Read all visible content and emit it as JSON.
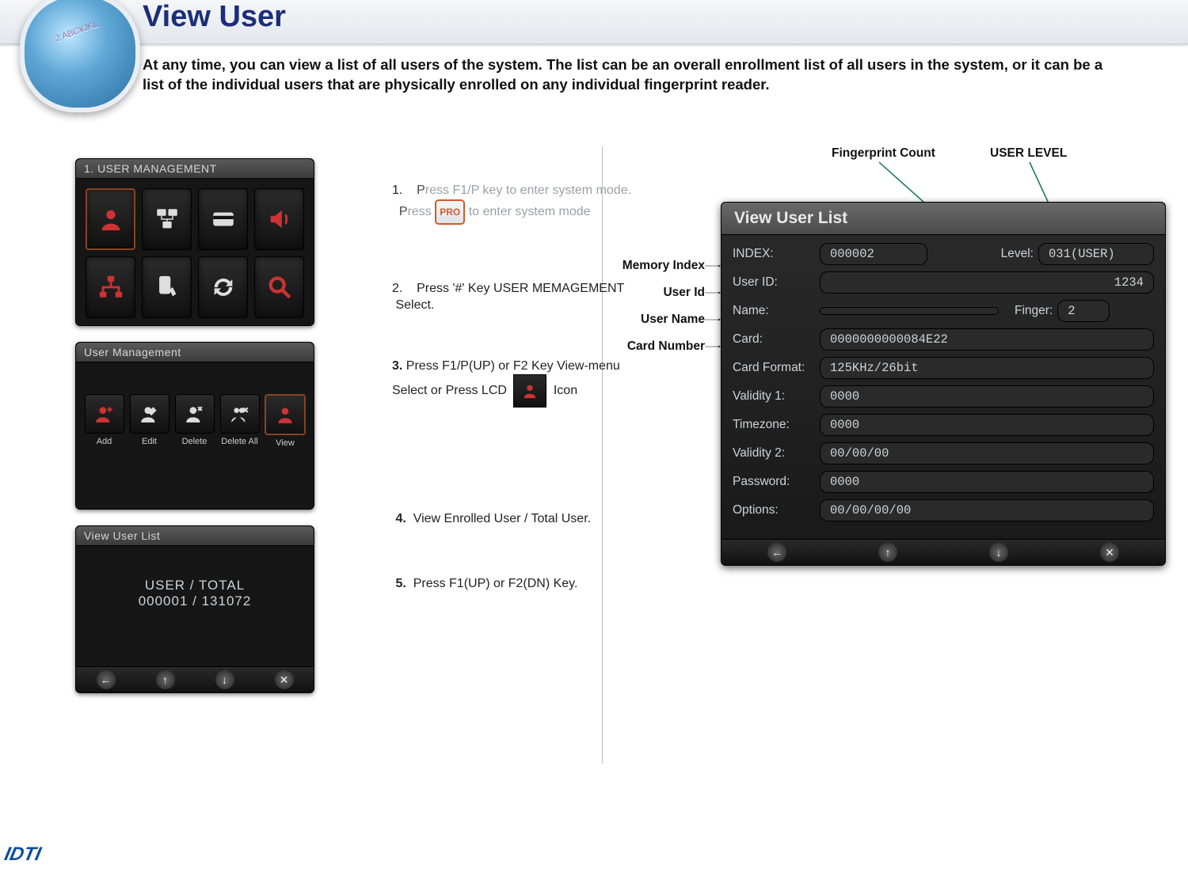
{
  "title": "View User",
  "intro": "At any time, you can view a list of all users of the system. The list can be an overall enrollment list of all users in the system, or it can be a list of the individual users that are physically enrolled on any individual fingerprint reader.",
  "panel1": {
    "title": "1. USER MANAGEMENT"
  },
  "panel2": {
    "title": "User Management",
    "items": [
      "Add",
      "Edit",
      "Delete",
      "Delete All",
      "View"
    ]
  },
  "panel3": {
    "title": "View User List",
    "counter_top": "USER     /    TOTAL",
    "counter_bottom": "000001   /   131072"
  },
  "steps": {
    "s1a": "1.",
    "s1b": "Press F1/P key to enter system mode.",
    "s1c": "Press",
    "s1d": "to enter system mode",
    "s2a": "2.",
    "s2b": "Press '#' Key USER MEMAGEMENT",
    "s2c": "Select.",
    "s3a": "3.",
    "s3b": "Press  F1/P(UP) or F2 Key   View-menu Select or  Press LCD",
    "s3c": "Icon",
    "s4a": "4.",
    "s4b": "View Enrolled User / Total User.",
    "s5a": "5.",
    "s5b": "Press F1(UP) or F2(DN) Key."
  },
  "labels": {
    "memindex": "Memory Index",
    "userid": "User Id",
    "username": "User Name",
    "cardnum": "Card Number",
    "fpcount": "Fingerprint Count",
    "userlevel": "USER LEVEL"
  },
  "detail": {
    "title": "View User List",
    "index_label": "INDEX:",
    "index": "000002",
    "level_label": "Level:",
    "level": "031(USER)",
    "userid_label": "User ID:",
    "userid": "1234",
    "name_label": "Name:",
    "name": "",
    "finger_label": "Finger:",
    "finger": "2",
    "card_label": "Card:",
    "card": "0000000000084E22",
    "cardfmt_label": "Card Format:",
    "cardfmt": "125KHz/26bit",
    "val1_label": "Validity 1:",
    "val1": "0000",
    "tz_label": "Timezone:",
    "tz": "0000",
    "val2_label": "Validity 2:",
    "val2": "00/00/00",
    "pw_label": "Password:",
    "pw": "0000",
    "opt_label": "Options:",
    "opt": "00/00/00/00"
  },
  "pro": "PRO",
  "logo": "IDTI"
}
